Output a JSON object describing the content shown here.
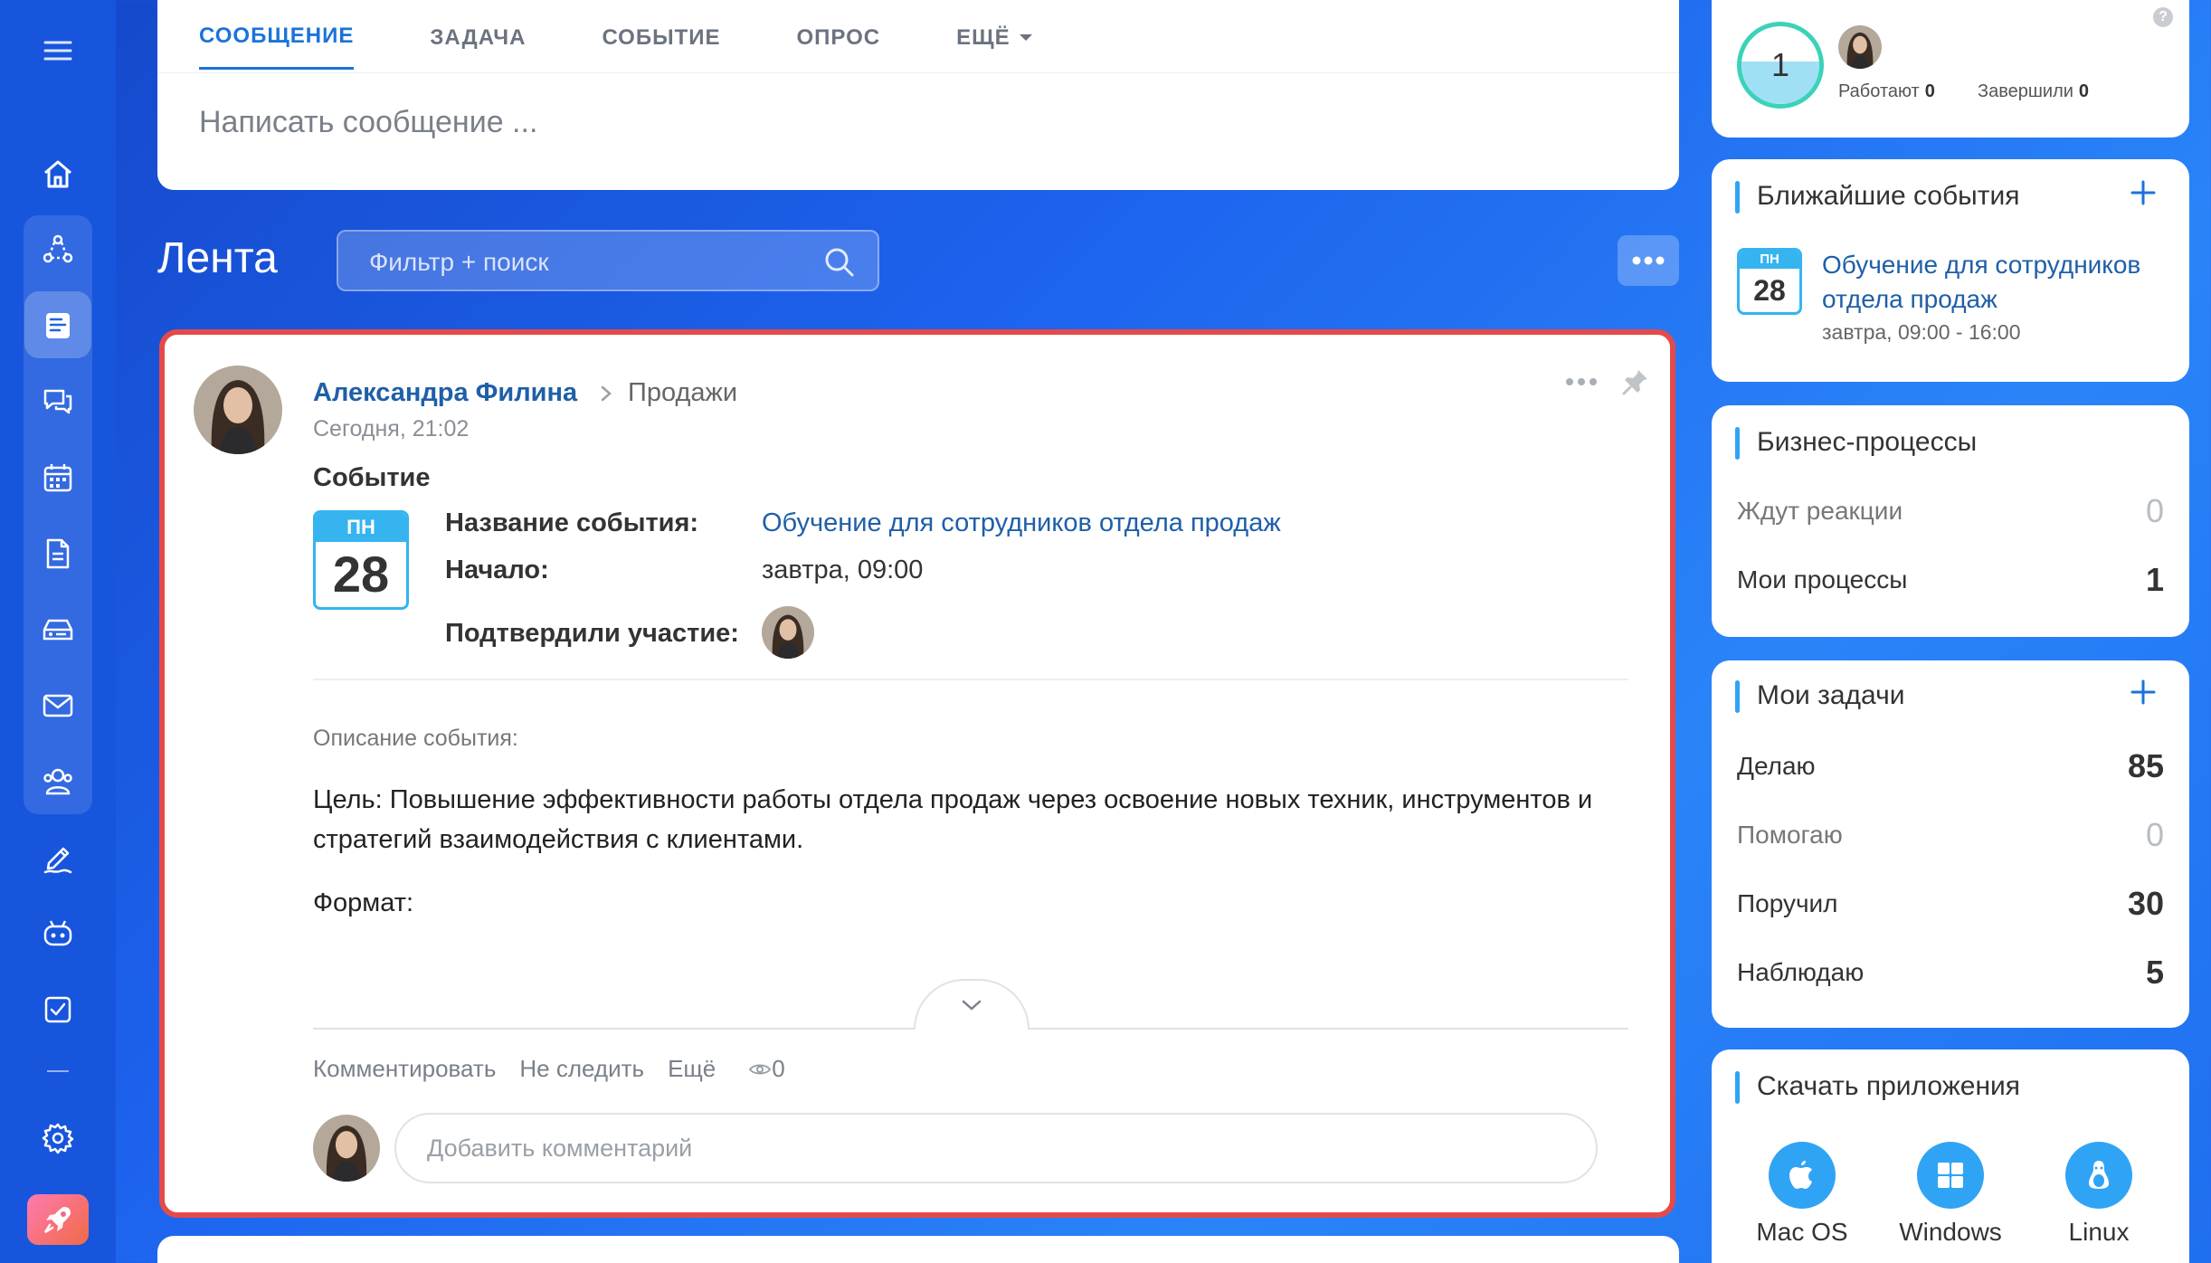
{
  "composer": {
    "tabs": [
      {
        "label": "СООБЩЕНИЕ"
      },
      {
        "label": "ЗАДАЧА"
      },
      {
        "label": "СОБЫТИЕ"
      },
      {
        "label": "ОПРОС"
      },
      {
        "label": "ЕЩЁ"
      }
    ],
    "placeholder": "Написать сообщение ..."
  },
  "feed": {
    "title": "Лента",
    "search_placeholder": "Фильтр + поиск"
  },
  "post": {
    "author": "Александра Филина",
    "group": "Продажи",
    "time": "Сегодня, 21:02",
    "type": "Событие",
    "calendar": {
      "weekday": "ПН",
      "day": "28"
    },
    "fields": {
      "name_label": "Название события:",
      "name_value": "Обучение для сотрудников отдела продаж",
      "start_label": "Начало:",
      "start_value": "завтра, 09:00",
      "confirmed_label": "Подтвердили участие:"
    },
    "description_label": "Описание события:",
    "description_text": "Цель: Повышение эффективности работы отдела продаж через освоение новых техник, инструментов и стратегий взаимодействия с клиентами.",
    "format_label": "Формат:",
    "actions": {
      "comment": "Комментировать",
      "unfollow": "Не следить",
      "more": "Ещё",
      "views": "0"
    },
    "comment_placeholder": "Добавить комментарий"
  },
  "worktime": {
    "count": "1",
    "working_label": "Работают",
    "working_value": "0",
    "finished_label": "Завершили",
    "finished_value": "0"
  },
  "events_widget": {
    "title": "Ближайшие события",
    "event": {
      "weekday": "ПН",
      "day": "28",
      "title": "Обучение для сотрудников отдела продаж",
      "time": "завтра, 09:00 - 16:00"
    }
  },
  "bp_widget": {
    "title": "Бизнес-процессы",
    "rows": [
      {
        "label": "Ждут реакции",
        "value": "0"
      },
      {
        "label": "Мои процессы",
        "value": "1"
      }
    ]
  },
  "tasks_widget": {
    "title": "Мои задачи",
    "rows": [
      {
        "label": "Делаю",
        "value": "85"
      },
      {
        "label": "Помогаю",
        "value": "0"
      },
      {
        "label": "Поручил",
        "value": "30"
      },
      {
        "label": "Наблюдаю",
        "value": "5"
      }
    ]
  },
  "apps_widget": {
    "title": "Скачать приложения",
    "apps": [
      {
        "name": "Mac OS",
        "icon": "apple-icon"
      },
      {
        "name": "Windows",
        "icon": "windows-icon"
      },
      {
        "name": "Linux",
        "icon": "linux-icon"
      }
    ]
  },
  "colors": {
    "accent": "#1b73d8",
    "link": "#1f5fa8",
    "highlight_border": "#e54a4a",
    "calendar": "#35b4f0"
  }
}
